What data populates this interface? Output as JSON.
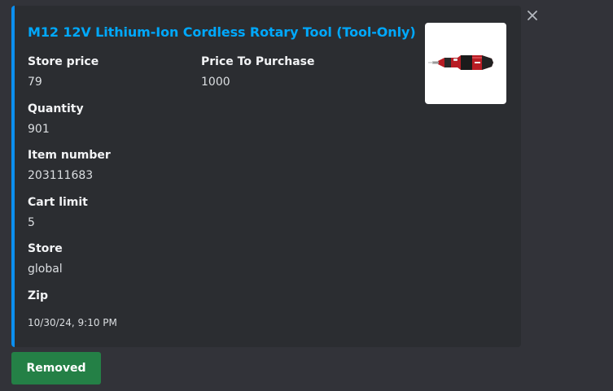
{
  "embed": {
    "accent_color": "#0b8ff0",
    "title": "M12 12V Lithium-Ion Cordless Rotary Tool (Tool-Only)",
    "fields": {
      "store_price": {
        "name": "Store price",
        "value": "79"
      },
      "price_to_purchase": {
        "name": "Price To Purchase",
        "value": "1000"
      },
      "quantity": {
        "name": "Quantity",
        "value": "901"
      },
      "item_number": {
        "name": "Item number",
        "value": "203111683"
      },
      "cart_limit": {
        "name": "Cart limit",
        "value": "5"
      },
      "store": {
        "name": "Store",
        "value": "global"
      },
      "zip": {
        "name": "Zip",
        "value": ""
      }
    },
    "thumbnail_icon": "rotary-tool-product-image",
    "timestamp": "10/30/24, 9:10 PM"
  },
  "close_icon": "close-icon",
  "actions": {
    "removed_label": "Removed",
    "removed_color": "#248046"
  }
}
